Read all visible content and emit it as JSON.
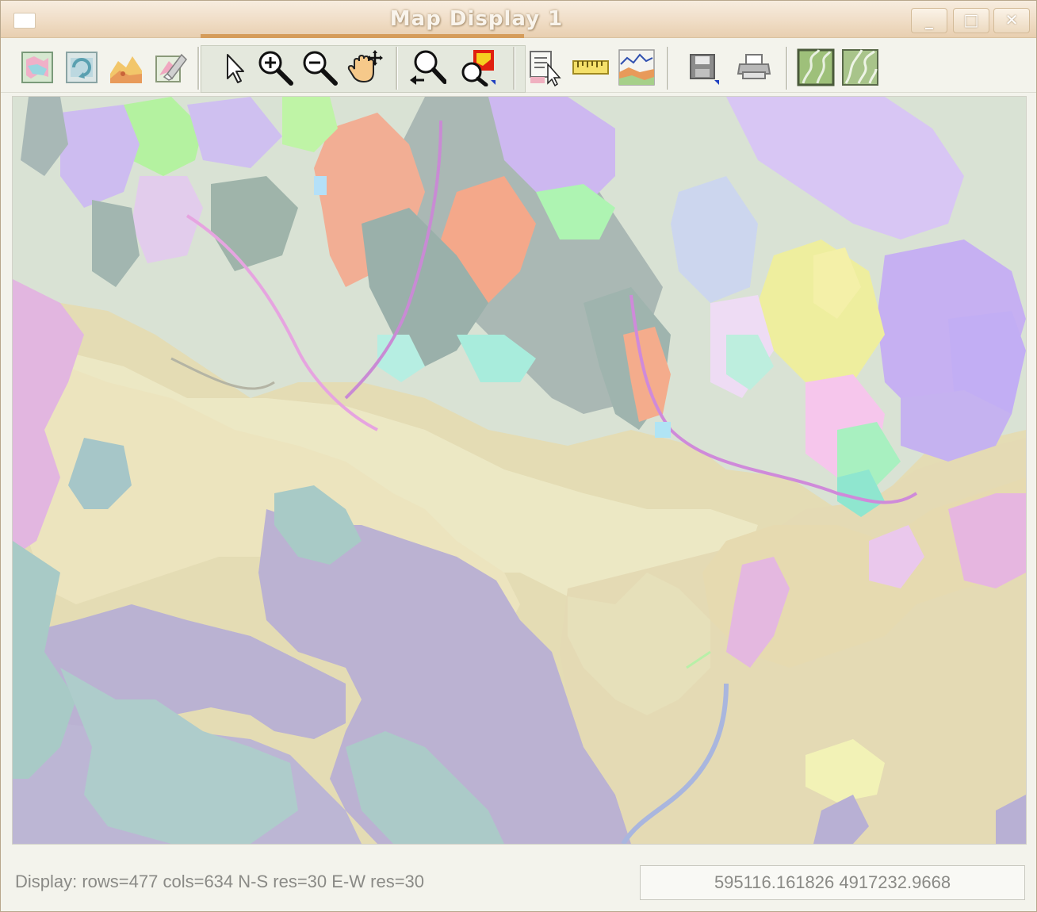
{
  "window": {
    "title": "Map Display 1",
    "minimize": "_",
    "maximize": "□",
    "close": "✕"
  },
  "toolbar": {
    "groups": [
      [
        "display-map",
        "redraw-all",
        "render-3d",
        "erase-display"
      ],
      [
        "pointer",
        "zoom-in",
        "zoom-out",
        "pan"
      ],
      [
        "zoom-back",
        "zoom-to-map"
      ],
      [
        "query",
        "measure",
        "profile"
      ],
      [
        "save-display",
        "print"
      ],
      [
        "overlay-mode-1",
        "overlay-mode-2"
      ]
    ],
    "active_tool": "pointer"
  },
  "status": {
    "display_info": "Display: rows=477 cols=634 N-S res=30 E-W res=30",
    "coordinates": "595116.161826 4917232.9668"
  },
  "colors": {
    "title_bar": "#f0ddc6",
    "toolbar_bg": "#f3f3ec",
    "active_underline": "#d59c5a"
  }
}
